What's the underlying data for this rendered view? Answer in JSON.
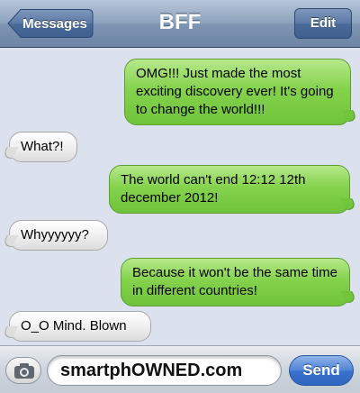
{
  "nav": {
    "back_label": "Messages",
    "title": "BFF",
    "edit_label": "Edit"
  },
  "messages": [
    {
      "direction": "sent",
      "text": "OMG!!! Just made the most exciting discovery ever! It's going to change the world!!!"
    },
    {
      "direction": "received",
      "text": "What?!"
    },
    {
      "direction": "sent",
      "text": "The world can't end 12:12 12th december 2012!"
    },
    {
      "direction": "received",
      "text": "Whyyyyyy?"
    },
    {
      "direction": "sent",
      "text": "Because it won't be the same time in different countries!"
    },
    {
      "direction": "received",
      "text": "O_O Mind. Blown"
    }
  ],
  "compose": {
    "input_value": "smartphOWNED.com",
    "send_label": "Send",
    "camera_icon": "camera-icon"
  },
  "colors": {
    "sent_bubble": "#85d24d",
    "received_bubble": "#eeeeee",
    "nav_bar": "#8ea3be",
    "send_button": "#4f84d6"
  }
}
